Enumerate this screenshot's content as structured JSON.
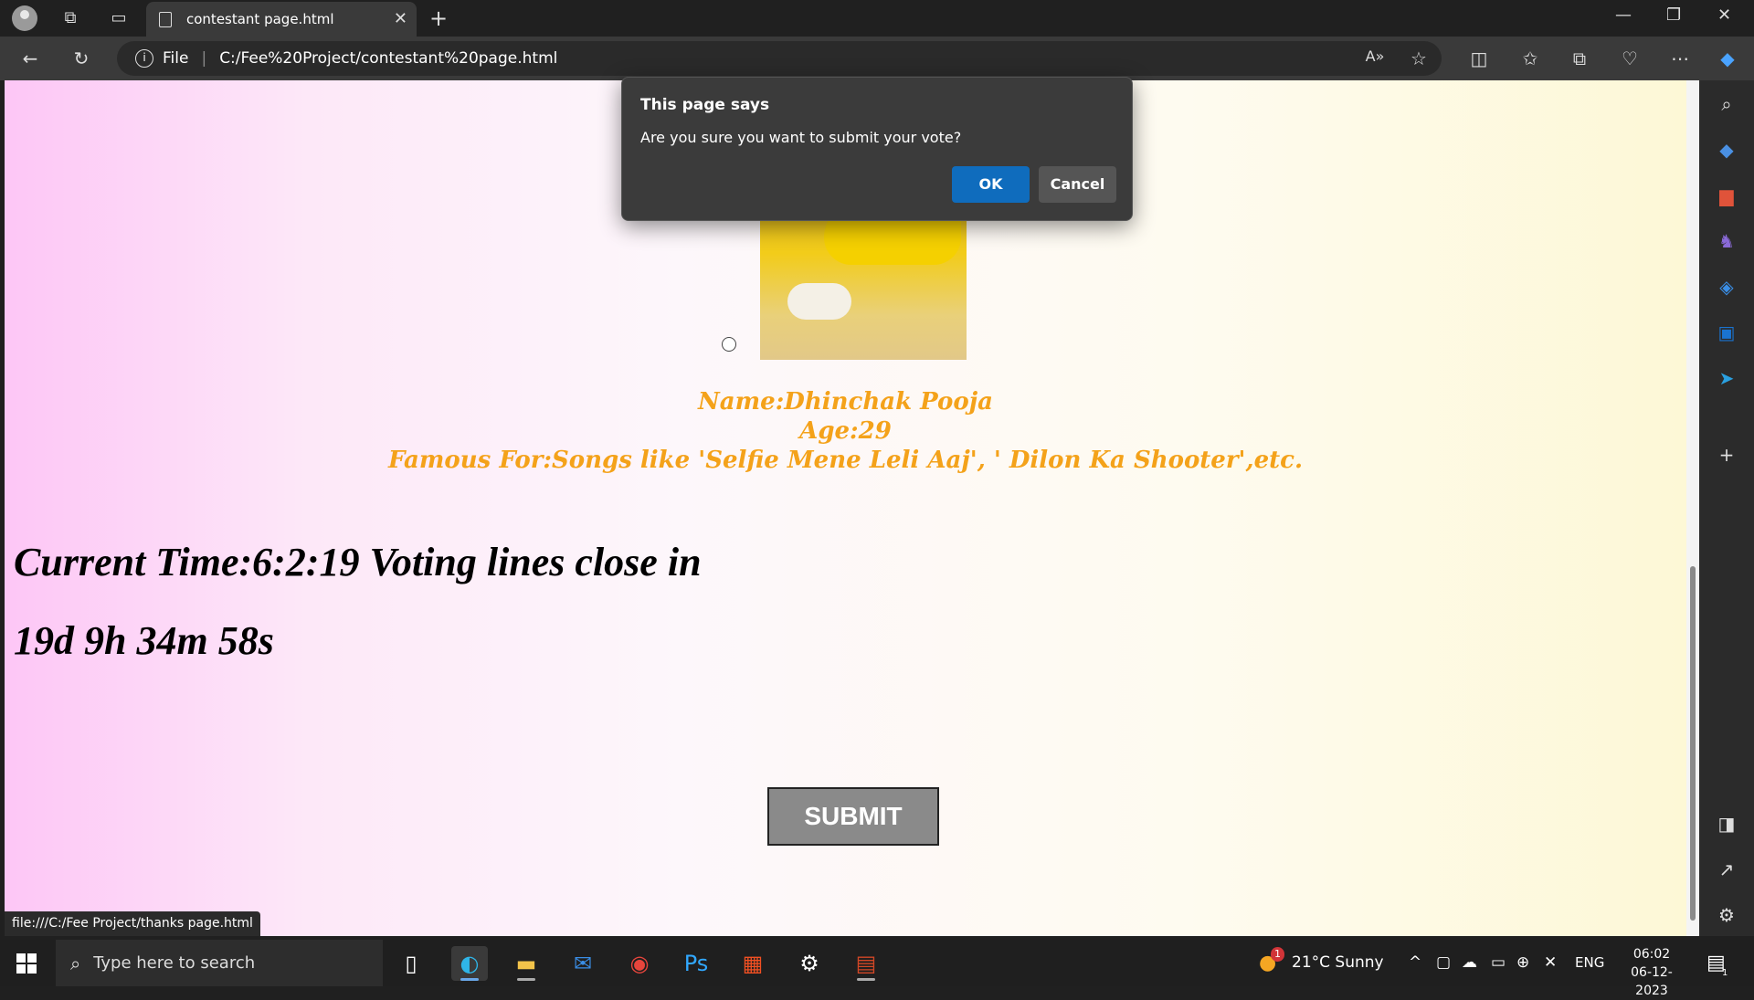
{
  "browser": {
    "tab_title": "contestant page.html",
    "tab_close": "✕",
    "new_tab": "+",
    "address_scheme": "File",
    "address_url": "C:/Fee%20Project/contestant%20page.html",
    "status_url": "file:///C:/Fee Project/thanks page.html"
  },
  "dialog": {
    "title": "This page says",
    "message": "Are you sure you want to submit your vote?",
    "ok_label": "OK",
    "cancel_label": "Cancel"
  },
  "contestant": {
    "name": "Name:Dhinchak Pooja",
    "age": "Age:29",
    "famous_for": "Famous For:Songs like 'Selfie Mene Leli Aaj', ' Dilon Ka Shooter',etc."
  },
  "timer": {
    "current_time": "Current Time:6:2:19 Voting lines close in",
    "countdown": "19d 9h 34m 58s"
  },
  "form": {
    "submit_label": "SUBMIT"
  },
  "taskbar": {
    "search_placeholder": "Type here to search",
    "weather": "21°C  Sunny",
    "weather_badge": "1",
    "language": "ENG",
    "time": "06:02",
    "date": "06-12-2023",
    "notification_count": "1"
  },
  "icons": {
    "tab": "document-icon",
    "dialog": "none",
    "taskbar_apps": [
      "task-view-icon",
      "edge-icon",
      "file-explorer-icon",
      "mail-icon",
      "chrome-icon",
      "photoshop-icon",
      "store-icon",
      "settings-icon",
      "powerpoint-icon"
    ]
  },
  "colors": {
    "accent": "#0f6cbd",
    "contestant_text": "#f4a21a",
    "submit_bg": "#8a8a8a"
  }
}
